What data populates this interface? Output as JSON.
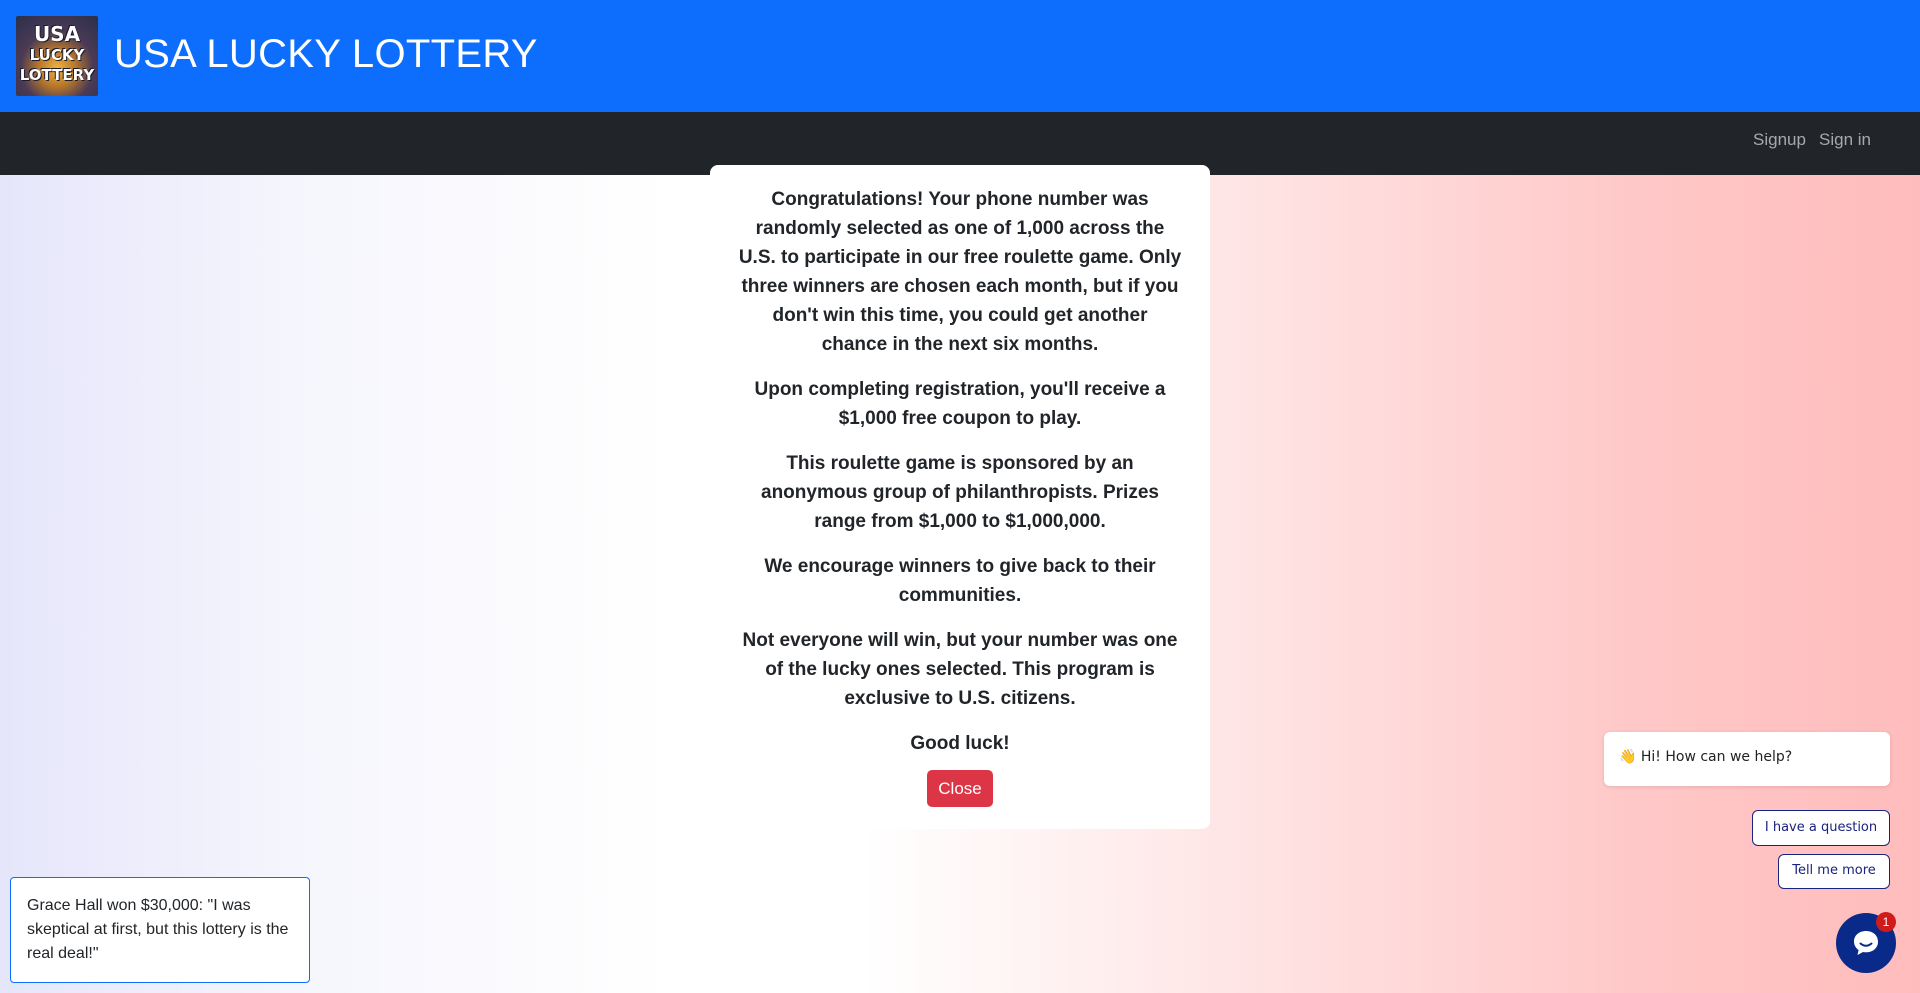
{
  "header": {
    "logo_text": [
      "USA",
      "LUCKY",
      "LOTTERY"
    ],
    "title": "USA LUCKY LOTTERY",
    "color": "#0d6efd"
  },
  "nav": {
    "signup_label": "Signup",
    "signin_label": "Sign in"
  },
  "modal": {
    "paragraphs": [
      "Congratulations! Your phone number was randomly selected as one of 1,000 across the U.S. to participate in our free roulette game. Only three winners are chosen each month, but if you don't win this time, you could get another chance in the next six months.",
      "Upon completing registration, you'll receive a $1,000 free coupon to play.",
      "This roulette game is sponsored by an anonymous group of philanthropists. Prizes range from $1,000 to $1,000,000.",
      "We encourage winners to give back to their communities.",
      "Not everyone will win, but your number was one of the lucky ones selected. This program is exclusive to U.S. citizens.",
      "Good luck!"
    ],
    "close_label": "Close",
    "close_color": "#dc3545"
  },
  "testimonial": {
    "text": "Grace Hall won $30,000: \"I was skeptical at first, but this lottery is the real deal!\""
  },
  "chat": {
    "greeting_icon": "waving-hand-icon",
    "greeting": "👋 Hi! How can we help?",
    "options": [
      "I have a question",
      "Tell me more"
    ],
    "launcher_icon": "chat-icon",
    "unread_count": "1"
  }
}
